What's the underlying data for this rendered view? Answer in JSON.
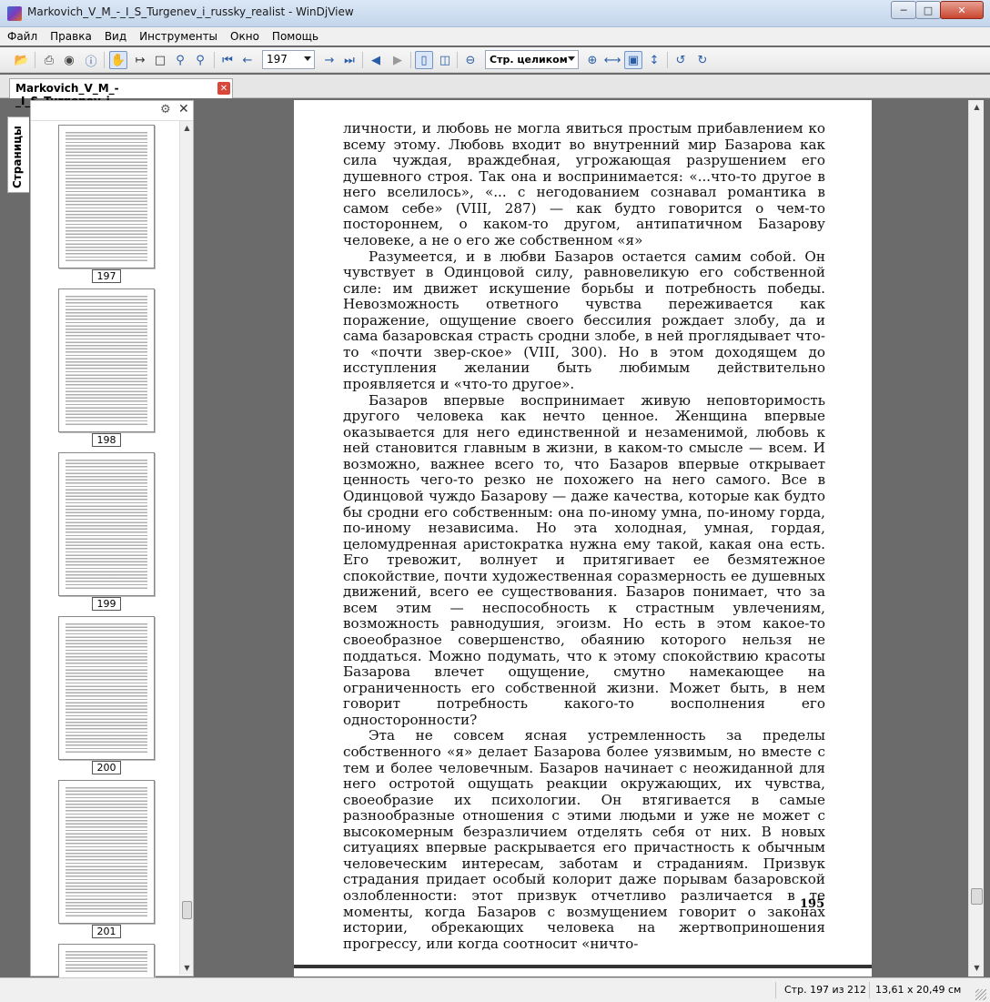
{
  "window": {
    "title": "Markovich_V_M_-_I_S_Turgenev_i_russky_realist - WinDjView"
  },
  "menu": [
    "Файл",
    "Правка",
    "Вид",
    "Инструменты",
    "Окно",
    "Помощь"
  ],
  "toolbar": {
    "page_value": "197",
    "zoom_value": "Стр. целиком"
  },
  "tab": {
    "label": "Markovich_V_M_-_I_S_Turgenev_i_..."
  },
  "sidebar": {
    "tab_label": "Страницы",
    "thumbnails": [
      "197",
      "198",
      "199",
      "200",
      "201"
    ]
  },
  "page": {
    "paragraphs": [
      "личности, и любовь не могла явиться простым прибавлением ко всему этому. Любовь входит во внутренний мир Базарова как сила чуждая, враждебная, угрожающая разрушением его душевного строя. Так она и воспринимается: «...что-то другое в него вселилось», «... с негодованием сознавал романтика в самом себе» (VIII, 287) — как будто говорится о чем-то постороннем, о каком-то другом, антипатичном Базарову человеке, а не о его же собственном «я»",
      "Разумеется, и в любви Базаров остается самим собой. Он чувствует в Одинцовой силу, равновеликую его собственной силе: им движет искушение борьбы и потребность победы. Невозможность ответного чувства переживается как поражение, ощущение своего бессилия рождает злобу, да и сама базаровская страсть сродни злобе, в ней проглядывает что-то «почти звер-ское» (VIII, 300). Но в этом доходящем до исступления желании быть любимым действительно проявляется и «что-то другое».",
      "Базаров впервые воспринимает живую неповторимость другого человека как нечто ценное. Женщина впервые оказывается для него единственной и незаменимой, любовь к ней становится главным в жизни, в каком-то смысле — всем. И возможно, важнее всего то, что Базаров впервые открывает ценность чего-то резко не похожего на него самого. Все в Одинцовой чуждо Базарову — даже качества, которые как будто бы сродни его собственным: она по-иному умна, по-иному горда, по-иному независима. Но эта холодная, умная, гордая, целомудренная аристократка нужна ему такой, какая она есть. Его тревожит, волнует и притягивает ее безмятежное спокойствие, почти художественная соразмерность ее душевных движений, всего ее существования. Базаров понимает, что за всем этим — неспособность к страстным увлечениям, возможность равнодушия, эгоизм. Но есть в этом какое-то своеобразное совершенство, обаянию которого нельзя не поддаться. Можно подумать, что к этому спокойствию красоты Базарова влечет ощущение, смутно намекающее на ограниченность его собственной жизни. Может быть, в нем говорит потребность какого-то восполнения его односторонности?",
      "Эта не совсем ясная устремленность за пределы собственного «я» делает Базарова более уязвимым, но вместе с тем и более человечным. Базаров начинает с неожиданной для него остротой ощущать реакции окружающих, их чувства, своеобразие их психологии. Он втягивается в самые разнообразные отношения с этими людьми и уже не может с высокомерным безразличием отделять себя от них. В новых ситуациях впервые раскрывается его причастность к обычным человеческим интересам, заботам и страданиям. Призвук страдания придает особый колорит даже порывам базаровской озлобленности: этот призвук отчетливо различается в те моменты, когда Базаров с возмущением говорит о законах истории, обрекающих человека на жертвоприношения прогрессу, или когда соотносит «ничто-"
    ],
    "number": "195"
  },
  "status": {
    "page_info": "Стр. 197 из 212",
    "page_size": "13,61 x 20,49 см"
  }
}
